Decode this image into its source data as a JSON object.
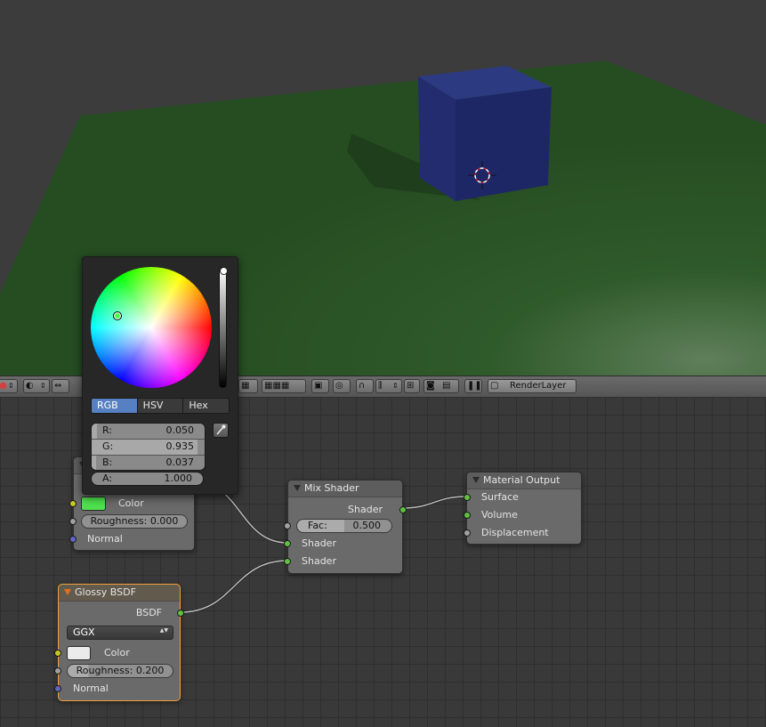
{
  "header": {
    "render_layer_label": "RenderLayer"
  },
  "picker": {
    "tabs": [
      "RGB",
      "HSV",
      "Hex"
    ],
    "active_tab": "RGB",
    "channels": [
      {
        "label": "R:",
        "value": "0.050",
        "fraction": 0.05
      },
      {
        "label": "G:",
        "value": "0.935",
        "fraction": 0.935
      },
      {
        "label": "B:",
        "value": "0.037",
        "fraction": 0.037
      }
    ],
    "alpha": {
      "label": "A:",
      "value": "1.000",
      "fraction": 1.0
    }
  },
  "nodes": {
    "diffuse": {
      "color_label": "Color",
      "color_swatch": "#4de14d",
      "roughness_label": "Roughness:",
      "roughness_value": "0.000",
      "normal_label": "Normal"
    },
    "glossy": {
      "title": "Glossy BSDF",
      "output_label": "BSDF",
      "distribution": "GGX",
      "color_label": "Color",
      "color_swatch": "#ebebeb",
      "roughness_label": "Roughness:",
      "roughness_value": "0.200",
      "normal_label": "Normal"
    },
    "mix": {
      "title": "Mix Shader",
      "output_label": "Shader",
      "fac_label": "Fac:",
      "fac_value": "0.500",
      "input1_label": "Shader",
      "input2_label": "Shader"
    },
    "output": {
      "title": "Material Output",
      "surface_label": "Surface",
      "volume_label": "Volume",
      "displacement_label": "Displacement"
    }
  },
  "colors": {
    "accent_blue": "#5680c2",
    "active_node_border": "#f0a040",
    "socket_shader": "#60c040",
    "socket_color": "#c7c729",
    "socket_value": "#a1a1a1",
    "socket_vector": "#6363c7"
  }
}
